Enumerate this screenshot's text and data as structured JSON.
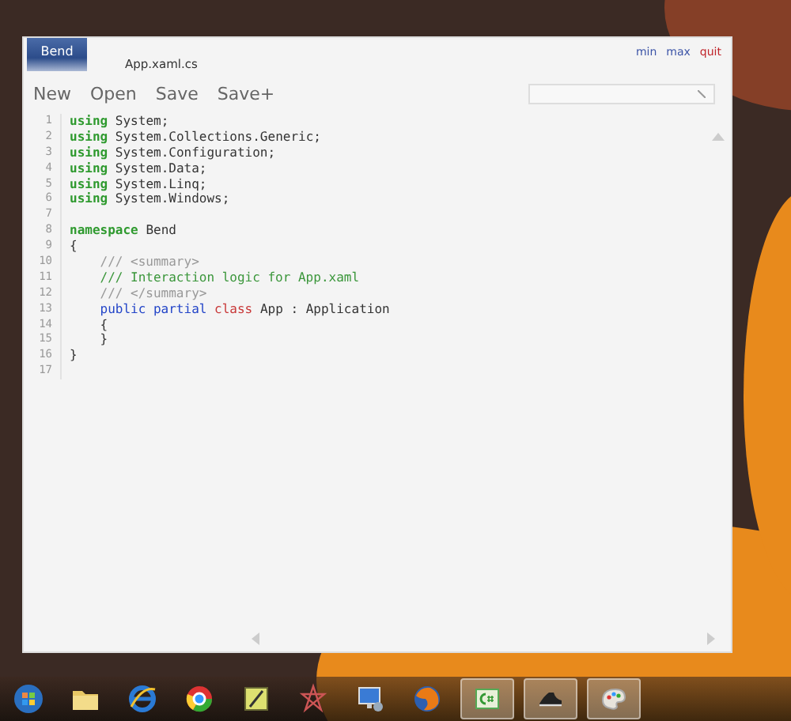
{
  "window": {
    "app_tab": "Bend",
    "file_tab": "App.xaml.cs",
    "controls": [
      {
        "label": "min",
        "kind": "normal"
      },
      {
        "label": "max",
        "kind": "normal"
      },
      {
        "label": "quit",
        "kind": "danger"
      }
    ]
  },
  "toolbar": [
    "New",
    "Open",
    "Save",
    "Save+"
  ],
  "editor": {
    "lines": [
      {
        "number": "1",
        "tokens": [
          {
            "text": "using",
            "kind": "keyword"
          },
          {
            "text": "System;",
            "kind": "plain"
          }
        ]
      },
      {
        "number": "2",
        "tokens": [
          {
            "text": "using",
            "kind": "keyword"
          },
          {
            "text": "System.Collections.Generic;",
            "kind": "plain"
          }
        ]
      },
      {
        "number": "3",
        "tokens": [
          {
            "text": "using",
            "kind": "keyword"
          },
          {
            "text": "System.Configuration;",
            "kind": "plain"
          }
        ]
      },
      {
        "number": "4",
        "tokens": [
          {
            "text": "using",
            "kind": "keyword"
          },
          {
            "text": "System.Data;",
            "kind": "plain"
          }
        ]
      },
      {
        "number": "5",
        "tokens": [
          {
            "text": "using",
            "kind": "keyword"
          },
          {
            "text": "System.Linq;",
            "kind": "plain"
          }
        ]
      },
      {
        "number": "6",
        "tokens": [
          {
            "text": "using",
            "kind": "keyword"
          },
          {
            "text": "System.Windows;",
            "kind": "plain"
          }
        ]
      },
      {
        "number": "7"
      },
      {
        "number": "8",
        "tokens": [
          {
            "text": "namespace",
            "kind": "keyword"
          },
          {
            "text": "Bend",
            "kind": "plain"
          }
        ]
      },
      {
        "number": "9",
        "tokens": [
          {
            "text": "{",
            "kind": "plain"
          }
        ]
      },
      {
        "number": "10",
        "tokens": [
          {
            "text": "    /// <summary>",
            "kind": "doc"
          }
        ]
      },
      {
        "number": "11",
        "tokens": [
          {
            "text": "    /// Interaction logic for App.xaml",
            "kind": "comment"
          }
        ]
      },
      {
        "number": "12",
        "tokens": [
          {
            "text": "    /// </summary>",
            "kind": "doc"
          }
        ]
      },
      {
        "number": "13",
        "tokens": [
          {
            "text": "    public partial",
            "kind": "modifier"
          },
          {
            "text": "class",
            "kind": "type"
          },
          {
            "text": "App : Application",
            "kind": "plain"
          }
        ]
      },
      {
        "number": "14",
        "tokens": [
          {
            "text": "    {",
            "kind": "plain"
          }
        ]
      },
      {
        "number": "15",
        "tokens": [
          {
            "text": "    }",
            "kind": "plain"
          }
        ]
      },
      {
        "number": "16",
        "tokens": [
          {
            "text": "}",
            "kind": "plain"
          }
        ]
      },
      {
        "number": "17"
      }
    ]
  },
  "taskbar": [
    {
      "kind": "start",
      "running": false
    },
    {
      "kind": "folder",
      "running": false
    },
    {
      "kind": "browser-e",
      "running": false
    },
    {
      "kind": "chrome",
      "running": false
    },
    {
      "kind": "note",
      "running": false
    },
    {
      "kind": "star",
      "running": false
    },
    {
      "kind": "monitor",
      "running": false
    },
    {
      "kind": "fox",
      "running": false
    },
    {
      "kind": "csharp",
      "running": true
    },
    {
      "kind": "shoe",
      "running": true
    },
    {
      "kind": "paint",
      "running": true
    }
  ]
}
